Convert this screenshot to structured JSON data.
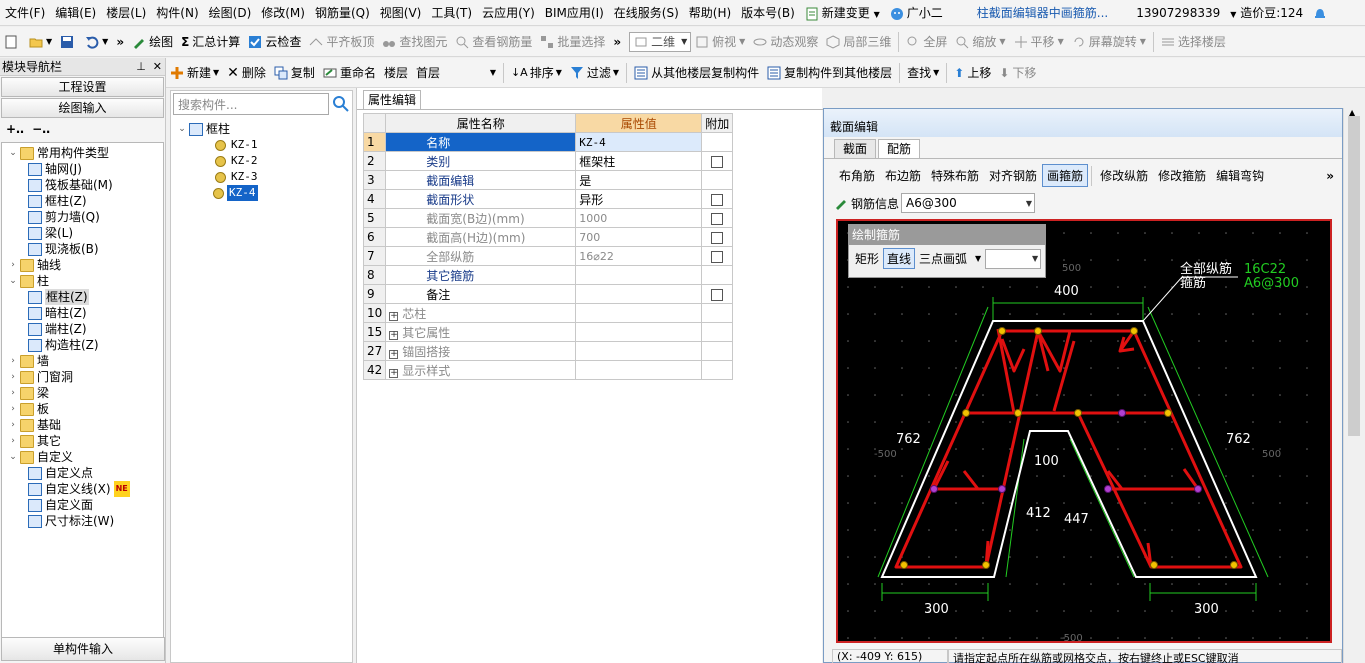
{
  "menubar": {
    "items": [
      "文件(F)",
      "编辑(E)",
      "楼层(L)",
      "构件(N)",
      "绘图(D)",
      "修改(M)",
      "钢筋量(Q)",
      "视图(V)",
      "工具(T)",
      "云应用(Y)",
      "BIM应用(I)",
      "在线服务(S)",
      "帮助(H)",
      "版本号(B)"
    ],
    "new_change": "新建变更",
    "assistant": "广小二",
    "doc_title": "柱截面编辑器中画箍筋...",
    "phone": "13907298339",
    "bean": "造价豆:124"
  },
  "toolbar1": {
    "draw": "绘图",
    "sum": "汇总计算",
    "cloud_check": "云检查",
    "flatten": "平齐板顶",
    "find_elem": "查找图元",
    "view_rebar": "查看钢筋量",
    "batch_select": "批量选择",
    "view_mode": "二维",
    "top_view": "俯视",
    "dynamic": "动态观察",
    "local3d": "局部三维",
    "fullscreen": "全屏",
    "zoom": "缩放",
    "pan": "平移",
    "rotate": "屏幕旋转",
    "select_floor": "选择楼层"
  },
  "leftnav": {
    "title": "模块导航栏",
    "project_settings": "工程设置",
    "drawing_input": "绘图输入",
    "single_input": "单构件输入",
    "tree": [
      {
        "label": "常用构件类型",
        "level": 0,
        "type": "folder",
        "expanded": true
      },
      {
        "label": "轴网(J)",
        "level": 1,
        "type": "comp"
      },
      {
        "label": "筏板基础(M)",
        "level": 1,
        "type": "comp"
      },
      {
        "label": "框柱(Z)",
        "level": 1,
        "type": "comp"
      },
      {
        "label": "剪力墙(Q)",
        "level": 1,
        "type": "comp"
      },
      {
        "label": "梁(L)",
        "level": 1,
        "type": "comp"
      },
      {
        "label": "现浇板(B)",
        "level": 1,
        "type": "comp"
      },
      {
        "label": "轴线",
        "level": 0,
        "type": "folder",
        "expanded": false
      },
      {
        "label": "柱",
        "level": 0,
        "type": "folder",
        "expanded": true
      },
      {
        "label": "框柱(Z)",
        "level": 1,
        "type": "comp",
        "selected": true
      },
      {
        "label": "暗柱(Z)",
        "level": 1,
        "type": "comp"
      },
      {
        "label": "端柱(Z)",
        "level": 1,
        "type": "comp"
      },
      {
        "label": "构造柱(Z)",
        "level": 1,
        "type": "comp"
      },
      {
        "label": "墙",
        "level": 0,
        "type": "folder",
        "expanded": false
      },
      {
        "label": "门窗洞",
        "level": 0,
        "type": "folder",
        "expanded": false
      },
      {
        "label": "梁",
        "level": 0,
        "type": "folder",
        "expanded": false
      },
      {
        "label": "板",
        "level": 0,
        "type": "folder",
        "expanded": false
      },
      {
        "label": "基础",
        "level": 0,
        "type": "folder",
        "expanded": false
      },
      {
        "label": "其它",
        "level": 0,
        "type": "folder",
        "expanded": false
      },
      {
        "label": "自定义",
        "level": 0,
        "type": "folder",
        "expanded": true
      },
      {
        "label": "自定义点",
        "level": 1,
        "type": "comp"
      },
      {
        "label": "自定义线(X)",
        "level": 1,
        "type": "comp",
        "badge": "NE"
      },
      {
        "label": "自定义面",
        "level": 1,
        "type": "comp"
      },
      {
        "label": "尺寸标注(W)",
        "level": 1,
        "type": "comp"
      }
    ]
  },
  "toolbar2": {
    "new": "新建",
    "delete": "删除",
    "copy": "复制",
    "rename": "重命名",
    "floor_label": "楼层",
    "floor_value": "首层",
    "sort": "排序",
    "filter": "过滤",
    "copy_from": "从其他楼层复制构件",
    "copy_to": "复制构件到其他楼层",
    "find": "查找",
    "up": "上移",
    "down": "下移"
  },
  "complist": {
    "search_placeholder": "搜索构件...",
    "root": "框柱",
    "items": [
      "KZ-1",
      "KZ-2",
      "KZ-3",
      "KZ-4"
    ],
    "selected_index": 3
  },
  "properties": {
    "tab": "属性编辑",
    "headers": {
      "name": "属性名称",
      "value": "属性值",
      "extra": "附加"
    },
    "rows": [
      {
        "num": "1",
        "name": "名称",
        "value": "KZ-4",
        "check": false,
        "gray": false,
        "selected": true
      },
      {
        "num": "2",
        "name": "类别",
        "value": "框架柱",
        "check": true,
        "gray": false
      },
      {
        "num": "3",
        "name": "截面编辑",
        "value": "是",
        "check": false,
        "gray": false
      },
      {
        "num": "4",
        "name": "截面形状",
        "value": "异形",
        "check": true,
        "gray": false
      },
      {
        "num": "5",
        "name": "截面宽(B边)(mm)",
        "value": "1000",
        "check": true,
        "gray": true
      },
      {
        "num": "6",
        "name": "截面高(H边)(mm)",
        "value": "700",
        "check": true,
        "gray": true
      },
      {
        "num": "7",
        "name": "全部纵筋",
        "value": "16⌀22",
        "check": true,
        "gray": true
      },
      {
        "num": "8",
        "name": "其它箍筋",
        "value": "",
        "check": false,
        "gray": false
      },
      {
        "num": "9",
        "name": "备注",
        "value": "",
        "check": true,
        "gray": false,
        "black": true
      },
      {
        "num": "10",
        "name": "芯柱",
        "value": "",
        "check": false,
        "gray": true,
        "group": true
      },
      {
        "num": "15",
        "name": "其它属性",
        "value": "",
        "check": false,
        "gray": true,
        "group": true
      },
      {
        "num": "27",
        "name": "锚固搭接",
        "value": "",
        "check": false,
        "gray": true,
        "group": true
      },
      {
        "num": "42",
        "name": "显示样式",
        "value": "",
        "check": false,
        "gray": true,
        "group": true
      }
    ]
  },
  "section_editor": {
    "title": "截面编辑",
    "tabs": [
      "截面",
      "配筋"
    ],
    "active_tab": 1,
    "tools": [
      "布角筋",
      "布边筋",
      "特殊布筋",
      "对齐钢筋",
      "画箍筋",
      "修改纵筋",
      "修改箍筋",
      "编辑弯钩"
    ],
    "active_tool": 4,
    "rebar_info_label": "钢筋信息",
    "rebar_info_value": "A6@300",
    "draw_panel": {
      "title": "绘制箍筋",
      "options": [
        "矩形",
        "直线",
        "三点画弧"
      ],
      "active": 1
    },
    "canvas": {
      "legend_all": "全部纵筋",
      "legend_all_value": "16C22",
      "legend_stirrup": "箍筋",
      "legend_stirrup_value": "A6@300",
      "dims": {
        "top": "400",
        "left": "762",
        "right": "762",
        "inner_top": "100",
        "inner_left": "412",
        "inner_right": "447",
        "bottom_left": "300",
        "bottom_right": "300"
      },
      "grid_labels": [
        "500",
        "-500",
        "500",
        "-500"
      ]
    },
    "status_coord": "(X: -409 Y: 615)",
    "status_msg": "请指定起点所在纵筋或网格交点，按右键终止或ESC键取消"
  },
  "colors": {
    "rebar": "#e01010",
    "outline": "#ffffff",
    "dim": "#22cc22",
    "selection": "#1464c8"
  }
}
